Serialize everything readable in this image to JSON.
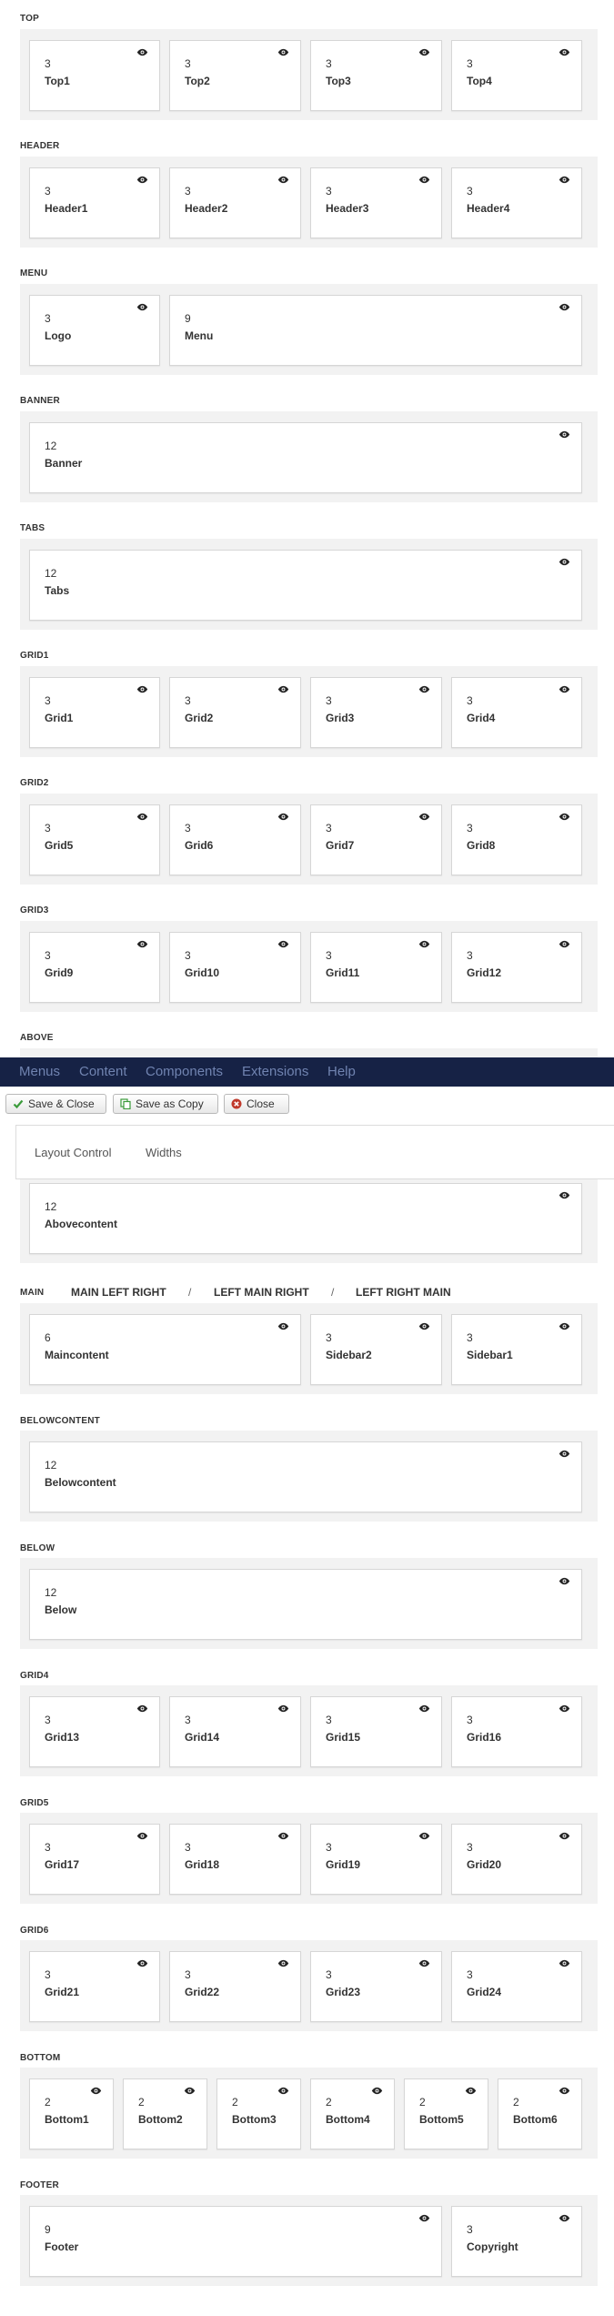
{
  "sections": {
    "top": {
      "title": "TOP",
      "cards": [
        {
          "num": "3",
          "name": "Top1"
        },
        {
          "num": "3",
          "name": "Top2"
        },
        {
          "num": "3",
          "name": "Top3"
        },
        {
          "num": "3",
          "name": "Top4"
        }
      ]
    },
    "header": {
      "title": "HEADER",
      "cards": [
        {
          "num": "3",
          "name": "Header1"
        },
        {
          "num": "3",
          "name": "Header2"
        },
        {
          "num": "3",
          "name": "Header3"
        },
        {
          "num": "3",
          "name": "Header4"
        }
      ]
    },
    "menu": {
      "title": "MENU",
      "cards": [
        {
          "num": "3",
          "name": "Logo"
        },
        {
          "num": "9",
          "name": "Menu"
        }
      ]
    },
    "banner": {
      "title": "BANNER",
      "cards": [
        {
          "num": "12",
          "name": "Banner"
        }
      ]
    },
    "tabs": {
      "title": "TABS",
      "cards": [
        {
          "num": "12",
          "name": "Tabs"
        }
      ]
    },
    "grid1": {
      "title": "GRID1",
      "cards": [
        {
          "num": "3",
          "name": "Grid1"
        },
        {
          "num": "3",
          "name": "Grid2"
        },
        {
          "num": "3",
          "name": "Grid3"
        },
        {
          "num": "3",
          "name": "Grid4"
        }
      ]
    },
    "grid2": {
      "title": "GRID2",
      "cards": [
        {
          "num": "3",
          "name": "Grid5"
        },
        {
          "num": "3",
          "name": "Grid6"
        },
        {
          "num": "3",
          "name": "Grid7"
        },
        {
          "num": "3",
          "name": "Grid8"
        }
      ]
    },
    "grid3": {
      "title": "GRID3",
      "cards": [
        {
          "num": "3",
          "name": "Grid9"
        },
        {
          "num": "3",
          "name": "Grid10"
        },
        {
          "num": "3",
          "name": "Grid11"
        },
        {
          "num": "3",
          "name": "Grid12"
        }
      ]
    },
    "above": {
      "title": "ABOVE",
      "cards": [
        {
          "num": "12",
          "name": "Abovecontent"
        }
      ]
    },
    "main": {
      "title": "MAIN",
      "options": [
        "MAIN LEFT RIGHT",
        "LEFT MAIN RIGHT",
        "LEFT RIGHT MAIN"
      ],
      "separator": "/",
      "cards": [
        {
          "num": "6",
          "name": "Maincontent"
        },
        {
          "num": "3",
          "name": "Sidebar2"
        },
        {
          "num": "3",
          "name": "Sidebar1"
        }
      ]
    },
    "belowcontent": {
      "title": "BELOWCONTENT",
      "cards": [
        {
          "num": "12",
          "name": "Belowcontent"
        }
      ]
    },
    "below": {
      "title": "BELOW",
      "cards": [
        {
          "num": "12",
          "name": "Below"
        }
      ]
    },
    "grid4": {
      "title": "GRID4",
      "cards": [
        {
          "num": "3",
          "name": "Grid13"
        },
        {
          "num": "3",
          "name": "Grid14"
        },
        {
          "num": "3",
          "name": "Grid15"
        },
        {
          "num": "3",
          "name": "Grid16"
        }
      ]
    },
    "grid5": {
      "title": "GRID5",
      "cards": [
        {
          "num": "3",
          "name": "Grid17"
        },
        {
          "num": "3",
          "name": "Grid18"
        },
        {
          "num": "3",
          "name": "Grid19"
        },
        {
          "num": "3",
          "name": "Grid20"
        }
      ]
    },
    "grid6": {
      "title": "GRID6",
      "cards": [
        {
          "num": "3",
          "name": "Grid21"
        },
        {
          "num": "3",
          "name": "Grid22"
        },
        {
          "num": "3",
          "name": "Grid23"
        },
        {
          "num": "3",
          "name": "Grid24"
        }
      ]
    },
    "bottom": {
      "title": "BOTTOM",
      "cards": [
        {
          "num": "2",
          "name": "Bottom1"
        },
        {
          "num": "2",
          "name": "Bottom2"
        },
        {
          "num": "2",
          "name": "Bottom3"
        },
        {
          "num": "2",
          "name": "Bottom4"
        },
        {
          "num": "2",
          "name": "Bottom5"
        },
        {
          "num": "2",
          "name": "Bottom6"
        }
      ]
    },
    "footer": {
      "title": "FOOTER",
      "cards": [
        {
          "num": "9",
          "name": "Footer"
        },
        {
          "num": "3",
          "name": "Copyright"
        }
      ]
    }
  },
  "navbar": {
    "items": [
      "Menus",
      "Content",
      "Components",
      "Extensions",
      "Help"
    ]
  },
  "toolbar": {
    "save_close": "Save & Close",
    "save_copy": "Save as Copy",
    "close": "Close"
  },
  "tabs": [
    "Layout Control",
    "Widths"
  ],
  "icons": {
    "card": "eye-icon",
    "save_close": "check-icon",
    "save_copy": "copy-icon",
    "close": "close-circle-icon"
  },
  "colors": {
    "navbar": "#162245",
    "navbar_text": "#7083b0",
    "band": "#f2f2f2",
    "check": "#3a9b3a",
    "close": "#c0392b"
  }
}
